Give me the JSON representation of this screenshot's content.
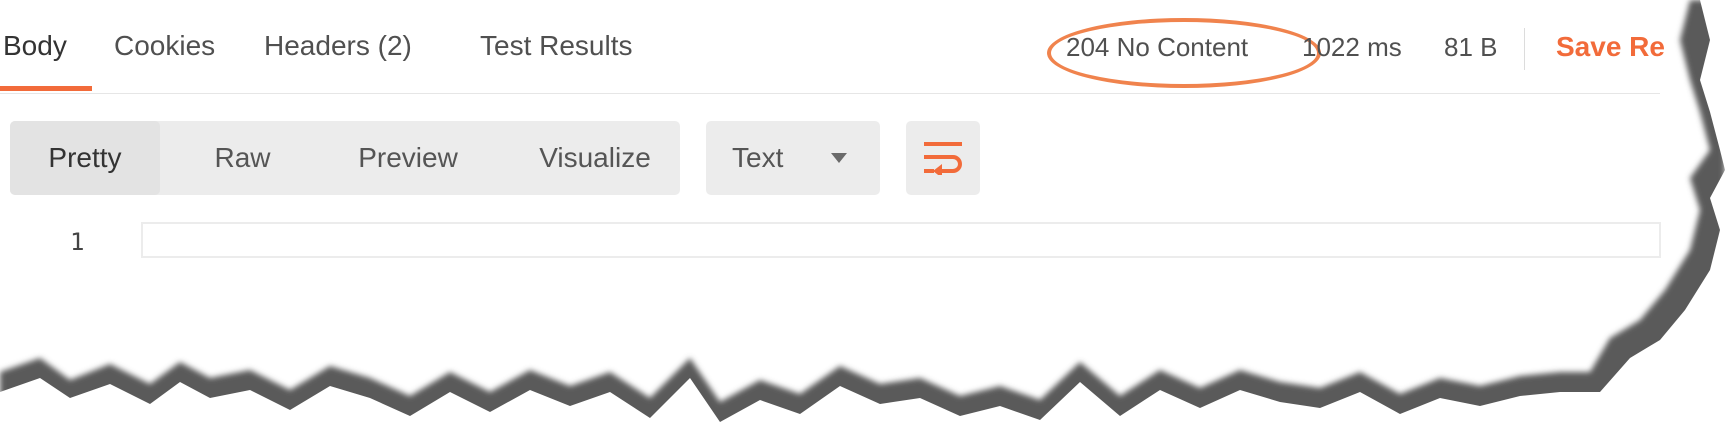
{
  "tabs": [
    {
      "label": "Body",
      "active": true
    },
    {
      "label": "Cookies",
      "active": false
    },
    {
      "label": "Headers  (2)",
      "active": false
    },
    {
      "label": "Test Results",
      "active": false
    }
  ],
  "response": {
    "status": "204 No Content",
    "time": "1022 ms",
    "size": "81 B",
    "save_label": "Save Re"
  },
  "format_modes": [
    {
      "label": "Pretty",
      "active": true
    },
    {
      "label": "Raw",
      "active": false
    },
    {
      "label": "Preview",
      "active": false
    },
    {
      "label": "Visualize",
      "active": false
    }
  ],
  "language_select": {
    "value": "Text"
  },
  "wrap_icon": "wrap-lines-icon",
  "editor": {
    "line_numbers": [
      "1"
    ],
    "lines": [
      ""
    ]
  },
  "colors": {
    "accent": "#f26b3a",
    "status_highlight": "#f0834d",
    "toolbar_bg": "#ececec"
  }
}
